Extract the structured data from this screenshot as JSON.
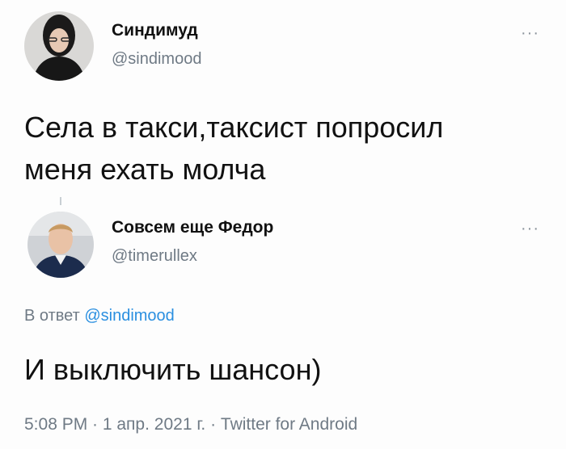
{
  "tweet1": {
    "display_name": "Синдимуд",
    "handle": "@sindimood",
    "more_label": "···",
    "text_line1": "Села в такси,таксист попросил",
    "text_line2": "меня ехать молча"
  },
  "tweet2": {
    "display_name": "Совсем еще Федор",
    "handle": "@timerullex",
    "more_label": "···",
    "reply_prefix": "В ответ",
    "reply_mention": "@sindimood",
    "text": "И выключить шансон)",
    "timestamp": "5:08 PM · 1 апр. 2021 г. · Twitter for Android"
  },
  "colors": {
    "mention": "#2a8fe0",
    "secondary_text": "#6f7a85"
  }
}
